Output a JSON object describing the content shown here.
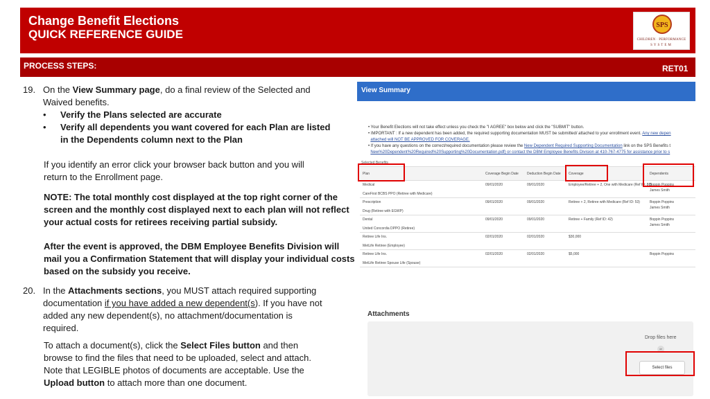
{
  "header": {
    "title_line1": "Change Benefit Elections",
    "title_line2": "QUICK REFERENCE GUIDE",
    "logo": {
      "letters": "SPS",
      "subtitle": "CHILDREN · PERFORMANCE",
      "subtitle2": "SYSTEM"
    },
    "band_color": "#c00000"
  },
  "process": {
    "label": "PROCESS STEPS:",
    "code": "RET01"
  },
  "step19": {
    "number": "19.",
    "intro_pre": "On the ",
    "intro_bold": "View Summary page",
    "intro_post": ", do a final review of the Selected and",
    "intro_line2": "Waived benefits.",
    "bullets": [
      "Verify the Plans selected are accurate",
      "Verify all dependents you want covered for each Plan are listed",
      "in the Dependents column next to the Plan"
    ],
    "error_line1": "If you identify an error click your browser back button and you will",
    "error_line2": "return to the Enrollment page.",
    "note_lines": [
      "NOTE:  The total monthly cost displayed at the top right corner of the",
      "screen and the monthly cost displayed next to each plan will not reflect",
      "your actual costs for retirees receiving partial subsidy."
    ],
    "after_lines": [
      "After the event is approved, the DBM Employee Benefits Division will",
      "mail you a Confirmation Statement that will display your individual costs",
      "based on the subsidy you receive."
    ]
  },
  "step20": {
    "number": "20.",
    "l1_pre": "In the ",
    "l1_bold": "Attachments sections",
    "l1_post": ", you MUST attach required supporting",
    "l2_pre": "documentation ",
    "l2_u": "if you have added a new dependent(s",
    "l2_post": "). If you have not",
    "l3": "added any new dependent(s), no attachment/documentation is",
    "l4": "required.",
    "p2_pre": "To attach a document(s), click the ",
    "p2_bold": "Select Files button",
    "p2_post": " and then",
    "p3": "browse to find the files that need to be uploaded, select and attach.",
    "p4": "Note that LEGIBLE photos of documents are acceptable. Use the",
    "p5_bold": "Upload button",
    "p5_post": " to attach more than one document."
  },
  "view_summary": {
    "title": "View Summary",
    "notes": [
      "Your Benefit Elections will not take effect unless you check the \"I AGREE\" box below and click the \"SUBMIT\" button.",
      "IMPORTANT : If a new dependent has been added, the required supporting documentation MUST be submitted/ attached to your enrollment event.",
      "attached will NOT BE APPROVED FOR COVERAGE.",
      "If you have any questions on the correct/required documentation please review the",
      "New%20Dependent%20Required%20Supporting%20Documentation.pdf) or contact the DBM Employee Benefits Division at 410-767-4775 for assistance prior to s"
    ],
    "note_links": {
      "any_new": "Any new depen",
      "doc_link": "New Dependent Required Supporting Documentation",
      "doc_link_after": " link on the SPS Benefits t"
    },
    "subheader": "Selected Benefits",
    "columns": [
      "Plan",
      "Coverage Begin Date",
      "Deduction Begin Date",
      "Coverage",
      "Dependents"
    ],
    "rows": [
      {
        "plan": "Medical",
        "sub": "CareFirst BCBS PPO (Retiree with Medicare)",
        "cbd": "09/01/2020",
        "dbd": "09/01/2020",
        "coverage": "Employee/Retiree + 2, One with Medicare (Ref ID: 86)",
        "dep1": "Boppin Poppins",
        "dep2": "James Smith"
      },
      {
        "plan": "Prescription",
        "sub": "Drug (Retiree with EGWP)",
        "cbd": "09/01/2020",
        "dbd": "09/01/2020",
        "coverage": "Retiree + 2, Retiree with Medicare (Ref ID: 53)",
        "dep1": "Boppin Poppins",
        "dep2": "James Smith"
      },
      {
        "plan": "Dental",
        "sub": "United Concordia DPPO (Retiree)",
        "cbd": "09/01/2020",
        "dbd": "09/01/2020",
        "coverage": "Retiree + Family (Ref ID: 42)",
        "dep1": "Boppin Poppins",
        "dep2": "James Smith"
      },
      {
        "plan": "Retiree Life Ins.",
        "sub": "MetLife Retiree (Employee)",
        "cbd": "02/01/2020",
        "dbd": "02/01/2020",
        "coverage": "$30,000",
        "dep1": "",
        "dep2": ""
      },
      {
        "plan": "Retiree Life Ins.",
        "sub": "MetLife Retiree Spouse Life (Spouse)",
        "cbd": "02/01/2020",
        "dbd": "02/01/2020",
        "coverage": "$5,000",
        "dep1": "Boppin Poppins",
        "dep2": ""
      }
    ]
  },
  "attachments": {
    "title": "Attachments",
    "drop_text": "Drop files here",
    "or_text": "or",
    "select_button": "Select files"
  }
}
